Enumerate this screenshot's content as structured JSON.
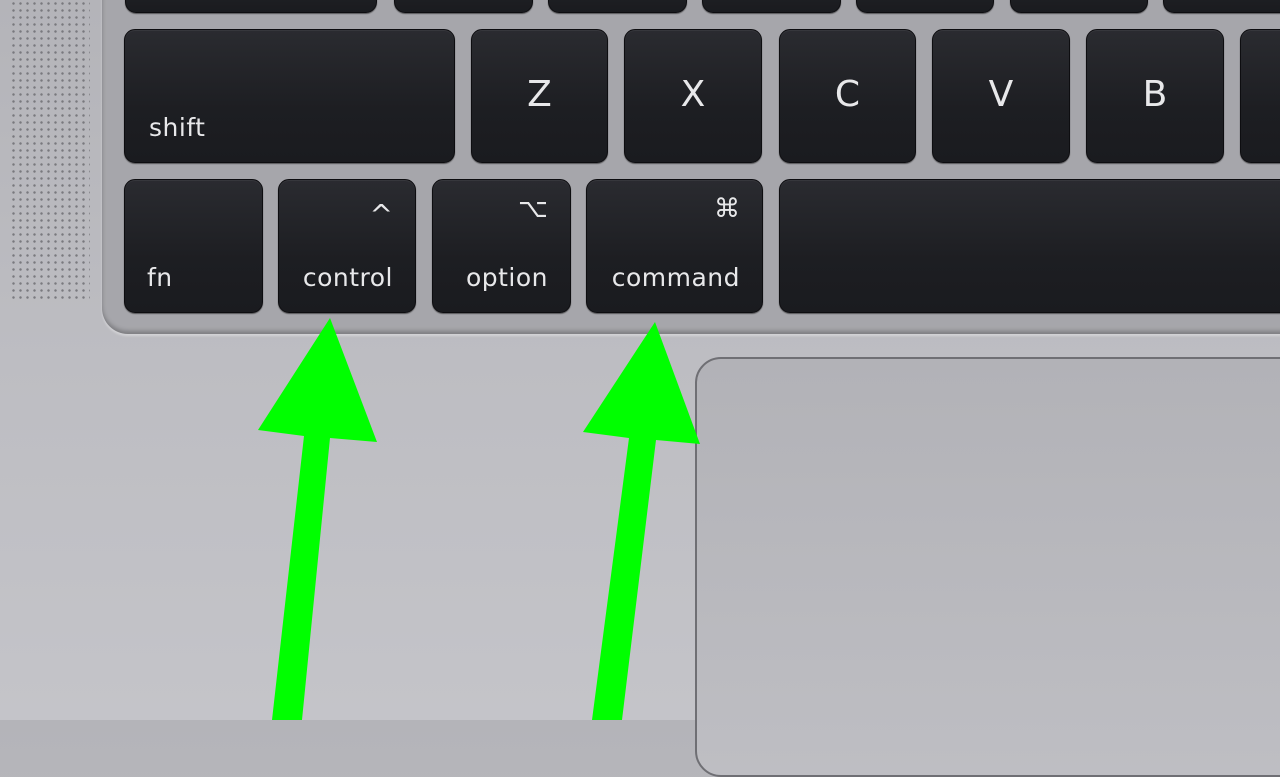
{
  "image": {
    "description": "MacBook keyboard closeup with green arrows pointing at control and command keys"
  },
  "keyboard": {
    "row2": [
      {
        "name": "shift",
        "label": "shift",
        "symbol": ""
      },
      {
        "name": "z",
        "label": "Z"
      },
      {
        "name": "x",
        "label": "X"
      },
      {
        "name": "c",
        "label": "C"
      },
      {
        "name": "v",
        "label": "V"
      },
      {
        "name": "b",
        "label": "B"
      }
    ],
    "row3": [
      {
        "name": "fn",
        "label": "fn",
        "symbol": ""
      },
      {
        "name": "control",
        "label": "control",
        "symbol": "^"
      },
      {
        "name": "option",
        "label": "option",
        "symbol": "⌥"
      },
      {
        "name": "command",
        "label": "command",
        "symbol": "⌘"
      },
      {
        "name": "space",
        "label": ""
      }
    ]
  },
  "annotations": {
    "arrow_color": "#00ff00",
    "arrows": [
      {
        "target": "control"
      },
      {
        "target": "command"
      }
    ]
  }
}
